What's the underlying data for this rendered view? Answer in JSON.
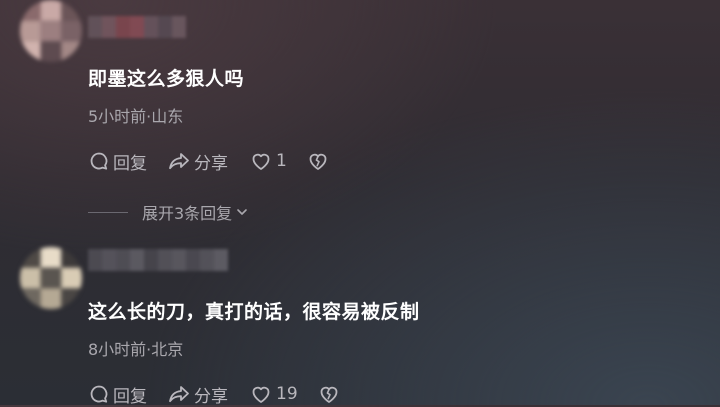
{
  "comments": [
    {
      "text": "即墨这么多狠人吗",
      "meta": "5小时前·山东",
      "reply_label": "回复",
      "share_label": "分享",
      "like_count": "1",
      "avatar_colors": [
        "#8a6a6c",
        "#c9a9a6",
        "#6b5558",
        "#b89a96",
        "#9c7f80",
        "#7a6266",
        "#d1b3ae",
        "#5e4b50",
        "#a38886"
      ],
      "name_mosaic_colors": [
        "#6a5a62",
        "#7e5d66",
        "#8a4a52",
        "#94505a",
        "#6e5a64",
        "#5a4e58",
        "#746068"
      ]
    },
    {
      "text": "这么长的刀，真打的话，很容易被反制",
      "meta": "8小时前·北京",
      "reply_label": "回复",
      "share_label": "分享",
      "like_count": "19",
      "avatar_colors": [
        "#4f4a46",
        "#e8dcc8",
        "#3d3a3a",
        "#cbbfa8",
        "#5a5550",
        "#d9ccb5",
        "#6e6860",
        "#b5a994",
        "#4a4644"
      ],
      "name_mosaic_colors": [
        "#56545c",
        "#625f68",
        "#5a5860",
        "#6a6870",
        "#4e4c54",
        "#5e5c64",
        "#66646c",
        "#54525a",
        "#605e66",
        "#6c6a72"
      ]
    }
  ],
  "expand_label": "展开3条回复",
  "icons": {
    "reply": "reply-bubble-icon",
    "share": "share-arrow-icon",
    "like": "heart-icon",
    "dislike": "broken-heart-icon",
    "expand": "chevron-down-icon"
  },
  "colors": {
    "text_primary": "#ffffff",
    "text_secondary": "#a9a7ad",
    "action_color": "#b9b7bd"
  }
}
